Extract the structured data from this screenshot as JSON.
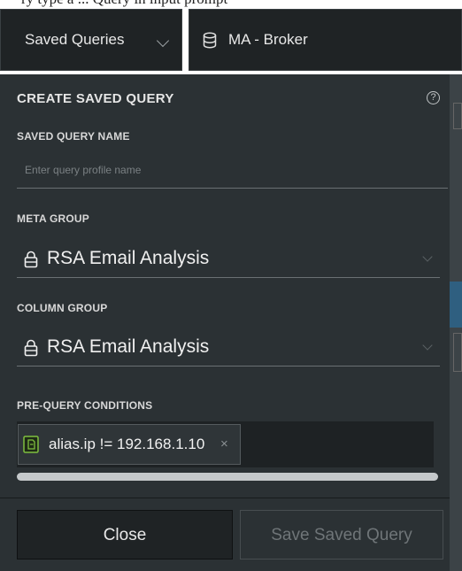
{
  "top_strip_text": "ry type a ... Query in input prompt",
  "toolbar": {
    "saved_queries_label": "Saved Queries",
    "service_label": "MA - Broker",
    "icons": [
      "chevron-down-icon",
      "database-icon"
    ]
  },
  "panel": {
    "title": "CREATE SAVED QUERY",
    "help_glyph": "?",
    "saved_query_name": {
      "label": "SAVED QUERY NAME",
      "value": "",
      "placeholder": "Enter query profile name"
    },
    "meta_group": {
      "label": "META GROUP",
      "value": "RSA Email Analysis",
      "icon": "lock-icon"
    },
    "column_group": {
      "label": "COLUMN GROUP",
      "value": "RSA Email Analysis",
      "icon": "lock-icon"
    },
    "pre_query_conditions": {
      "label": "PRE-QUERY CONDITIONS",
      "pills": [
        {
          "text": "alias.ip != 192.168.1.10",
          "remove": "×",
          "icon": "condition-icon"
        }
      ]
    }
  },
  "footer": {
    "close_label": "Close",
    "save_label": "Save Saved Query"
  },
  "colors": {
    "panel_bg": "#2b3134",
    "dropdown_bg": "#1f2325",
    "text": "#f0f0f0",
    "condition_icon": "#7fbf3f"
  }
}
